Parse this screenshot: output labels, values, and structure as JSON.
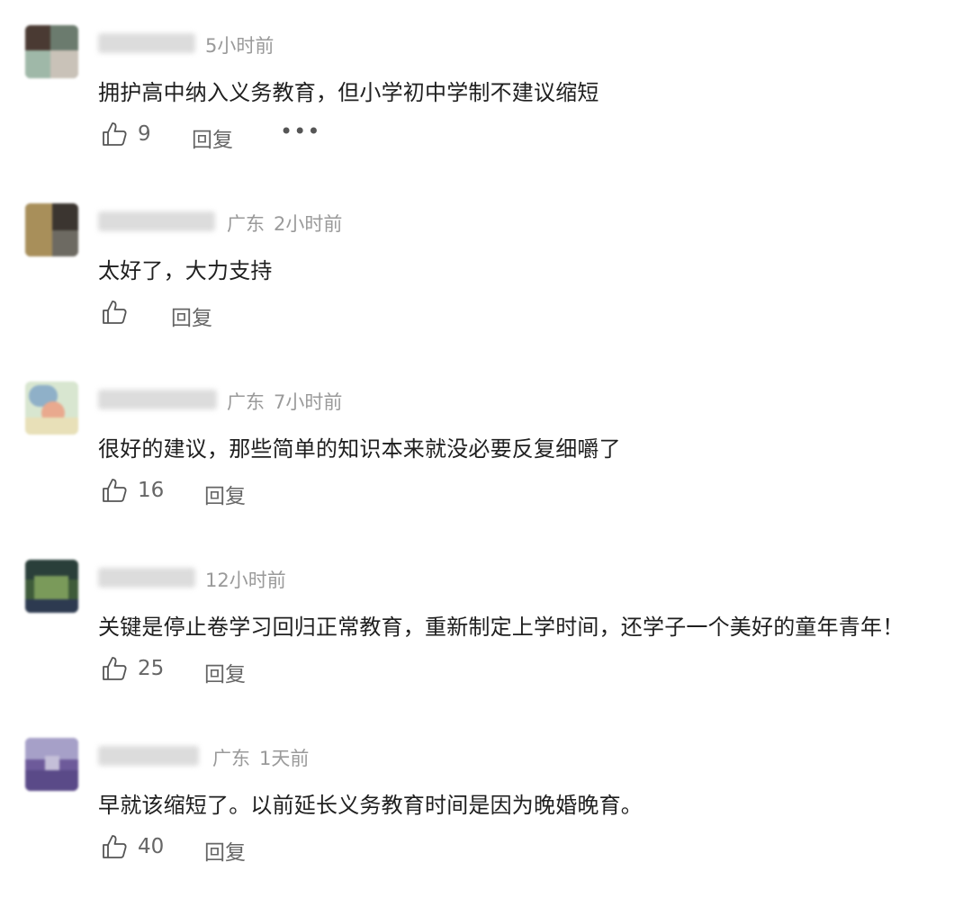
{
  "comments": [
    {
      "location": "",
      "time": "5小时前",
      "text": "拥护高中纳入义务教育，但小学初中学制不建议缩短",
      "likes": "9",
      "reply_label": "回复",
      "more": "•••"
    },
    {
      "location": "广东",
      "time": "2小时前",
      "text": "太好了，大力支持",
      "likes": "",
      "reply_label": "回复"
    },
    {
      "location": "广东",
      "time": "7小时前",
      "text": "很好的建议，那些简单的知识本来就没必要反复细嚼了",
      "likes": "16",
      "reply_label": "回复"
    },
    {
      "location": "",
      "time": "12小时前",
      "text": "关键是停止卷学习回归正常教育，重新制定上学时间，还学子一个美好的童年青年！",
      "likes": "25",
      "reply_label": "回复"
    },
    {
      "location": "广东",
      "time": "1天前",
      "text": "早就该缩短了。以前延长义务教育时间是因为晚婚晚育。",
      "likes": "40",
      "reply_label": "回复"
    }
  ],
  "colors": {
    "meta": "#9a9a9a",
    "text": "#1f1f1f",
    "action": "#666666"
  }
}
